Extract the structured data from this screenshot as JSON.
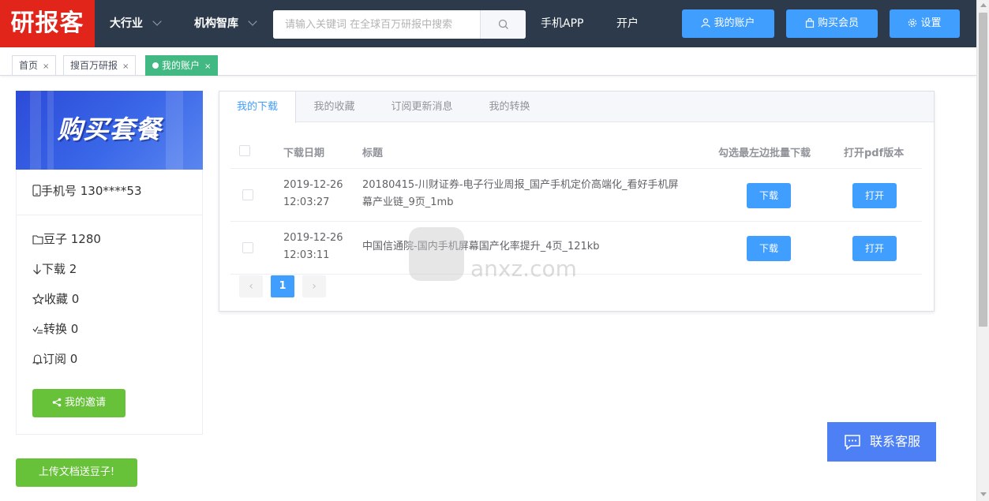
{
  "header": {
    "logo": "研报客",
    "nav": [
      {
        "label": "大行业"
      },
      {
        "label": "机构智库"
      }
    ],
    "search": {
      "placeholder": "请输入关键词 在全球百万研报中搜索",
      "value": ""
    },
    "links": [
      {
        "label": "手机APP"
      },
      {
        "label": "开户"
      }
    ],
    "buttons": {
      "account": "我的账户",
      "buy_member": "购买会员",
      "settings": "设置"
    }
  },
  "tabs": [
    {
      "label": "首页",
      "active": false
    },
    {
      "label": "搜百万研报",
      "active": false
    },
    {
      "label": "我的账户",
      "active": true
    }
  ],
  "tab_close": "×",
  "sidebar": {
    "banner": "购买套餐",
    "phone": "手机号 130****53",
    "stats": [
      {
        "label": "豆子 1280",
        "icon": "folder-icon"
      },
      {
        "label": "下载 2",
        "icon": "arrow-down-icon"
      },
      {
        "label": "收藏 0",
        "icon": "star-icon"
      },
      {
        "label": "转换 0",
        "icon": "convert-icon"
      },
      {
        "label": "订阅 0",
        "icon": "bell-icon"
      }
    ],
    "invite_button": "我的邀请",
    "upload_button": "上传文档送豆子!"
  },
  "main": {
    "tabs": [
      {
        "label": "我的下载",
        "active": true
      },
      {
        "label": "我的收藏",
        "active": false
      },
      {
        "label": "订阅更新消息",
        "active": false
      },
      {
        "label": "我的转换",
        "active": false
      }
    ],
    "table": {
      "headers": {
        "date": "下载日期",
        "title": "标题",
        "batch": "勾选最左边批量下载",
        "pdf": "打开pdf版本"
      },
      "rows": [
        {
          "date": "2019-12-26",
          "time": "12:03:27",
          "title_line1": "20180415-川财证券-电子行业周报_国产手机定价高端化_看好手机屏",
          "title_line2": "幕产业链_9页_1mb",
          "download": "下载",
          "open": "打开"
        },
        {
          "date": "2019-12-26",
          "time": "12:03:11",
          "title_line1": "中国信通院-国内手机屏幕国产化率提升_4页_121kb",
          "title_line2": "",
          "download": "下载",
          "open": "打开"
        }
      ]
    },
    "pagination": {
      "prev": "‹",
      "current": "1",
      "next": "›"
    }
  },
  "customer_service": "联系客服",
  "watermark": "anxz.com",
  "colors": {
    "header_bg": "#2d3a4b",
    "logo_bg": "#e1251b",
    "primary": "#409eff",
    "success": "#67c23a",
    "active_tag": "#42b983",
    "service": "#4e80f5"
  }
}
